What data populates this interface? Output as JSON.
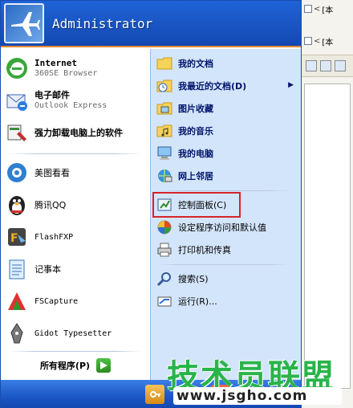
{
  "background_window": {
    "rows": [
      "[本",
      "[本"
    ]
  },
  "start_menu": {
    "user_name": "Administrator",
    "left": {
      "pinned": [
        {
          "title": "Internet",
          "subtitle": "360SE Browser",
          "icon": "globe-e-icon"
        },
        {
          "title": "电子邮件",
          "subtitle": "Outlook Express",
          "icon": "email-icon"
        },
        {
          "title": "强力卸载电脑上的软件",
          "icon": "uninstaller-icon"
        }
      ],
      "recent": [
        {
          "label": "美图看看",
          "icon": "meitu-viewer-icon"
        },
        {
          "label": "腾讯QQ",
          "icon": "qq-penguin-icon"
        },
        {
          "label": "FlashFXP",
          "icon": "flashfxp-icon"
        },
        {
          "label": "记事本",
          "icon": "notepad-icon"
        },
        {
          "label": "FSCapture",
          "icon": "fscapture-icon"
        },
        {
          "label": "Gidot Typesetter",
          "icon": "gidot-pen-icon"
        }
      ],
      "all_programs": "所有程序(P)"
    },
    "right": {
      "group1": [
        {
          "label": "我的文档",
          "icon": "my-documents-icon"
        },
        {
          "label": "我最近的文档(D)",
          "icon": "recent-documents-icon",
          "has_submenu": true
        },
        {
          "label": "图片收藏",
          "icon": "my-pictures-icon"
        },
        {
          "label": "我的音乐",
          "icon": "my-music-icon"
        },
        {
          "label": "我的电脑",
          "icon": "my-computer-icon"
        },
        {
          "label": "网上邻居",
          "icon": "network-places-icon"
        }
      ],
      "group2": [
        {
          "label": "控制面板(C)",
          "icon": "control-panel-icon",
          "highlighted": true
        },
        {
          "label": "设定程序访问和默认值",
          "icon": "program-defaults-icon"
        },
        {
          "label": "打印机和传真",
          "icon": "printer-icon"
        }
      ],
      "group3": [
        {
          "label": "搜索(S)",
          "icon": "search-icon"
        },
        {
          "label": "运行(R)...",
          "icon": "run-icon"
        }
      ]
    },
    "highlight_color": "#d8232a"
  },
  "watermark": {
    "text": "技术员联盟",
    "url": "www.jsgho.com"
  }
}
